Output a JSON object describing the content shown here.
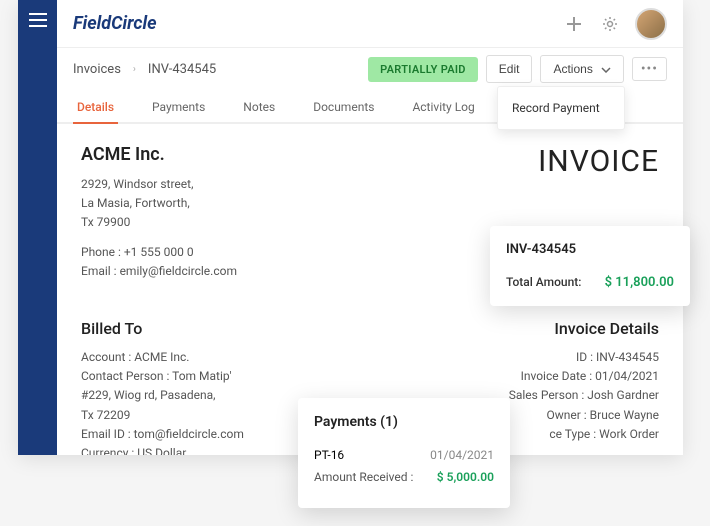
{
  "brand": "FieldCircle",
  "breadcrumb": {
    "root": "Invoices",
    "current": "INV-434545"
  },
  "status_badge": "PARTIALLY PAID",
  "buttons": {
    "edit": "Edit",
    "actions": "Actions"
  },
  "actions_menu": {
    "record_payment": "Record Payment"
  },
  "tabs": {
    "details": "Details",
    "payments": "Payments",
    "notes": "Notes",
    "documents": "Documents",
    "activity": "Activity Log"
  },
  "invoice_heading": "INVOICE",
  "company": {
    "name": "ACME Inc.",
    "addr1": "2929, Windsor street,",
    "addr2": "La Masia, Fortworth,",
    "addr3": "Tx 79900",
    "phone": "Phone : +1 555 000 0",
    "email": "Email : emily@fieldcircle.com"
  },
  "billed_to": {
    "title": "Billed To",
    "account": "Account : ACME Inc.",
    "contact": "Contact Person : Tom Matip'",
    "addr1": "#229, Wiog rd, Pasadena,",
    "addr2": "Tx 72209",
    "email": "Email ID : tom@fieldcircle.com",
    "currency": "Currency : US Dollar"
  },
  "invoice_details": {
    "title": "Invoice Details",
    "id": "ID : INV-434545",
    "date": "Invoice Date : 01/04/2021",
    "sales": "Sales Person : Josh Gardner",
    "owner": "Owner : Bruce Wayne",
    "type": "ce Type : Work Order"
  },
  "summary_popup": {
    "inv_no": "INV-434545",
    "total_label": "Total Amount:",
    "total_value": "$ 11,800.00"
  },
  "payments_popup": {
    "title": "Payments (1)",
    "pt_id": "PT-16",
    "pt_date": "01/04/2021",
    "amt_label": "Amount Received :",
    "amt_value": "$ 5,000.00"
  }
}
